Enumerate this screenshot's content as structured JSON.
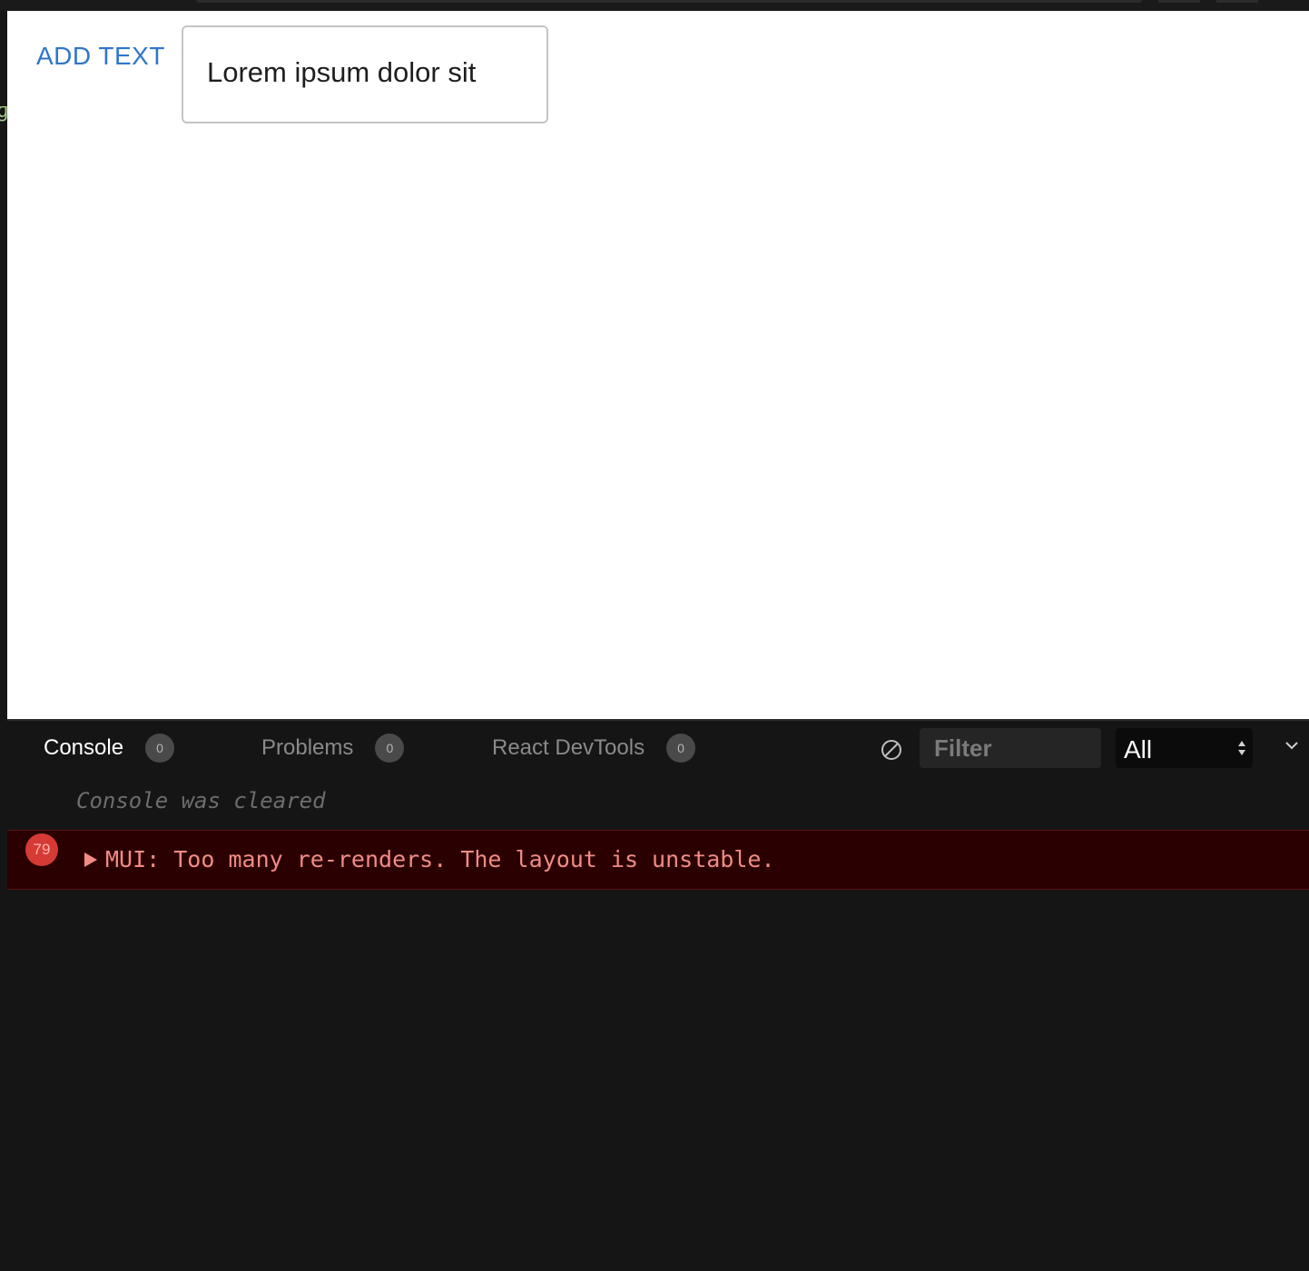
{
  "preview": {
    "add_text_label": "ADD TEXT",
    "text_field_value": "Lorem ipsum dolor sit"
  },
  "devtools": {
    "tabs": [
      {
        "label": "Console",
        "count": "0",
        "active": true
      },
      {
        "label": "Problems",
        "count": "0",
        "active": false
      },
      {
        "label": "React DevTools",
        "count": "0",
        "active": false
      }
    ],
    "filter_placeholder": "Filter",
    "level_selected": "All",
    "console": {
      "cleared_message": "Console was cleared",
      "error": {
        "repeat_count": "79",
        "message": "MUI: Too many re-renders. The layout is unstable."
      }
    }
  },
  "colors": {
    "accent_blue": "#2f76c9",
    "error_bg": "#2a0000",
    "error_text": "#f28b85",
    "error_badge": "#d63a35",
    "panel_bg": "#151515"
  },
  "icons": {
    "clear": "clear-console-icon",
    "select_arrows": "updown-arrows-icon",
    "collapse": "chevron-down-icon",
    "expand": "triangle-right-icon"
  }
}
